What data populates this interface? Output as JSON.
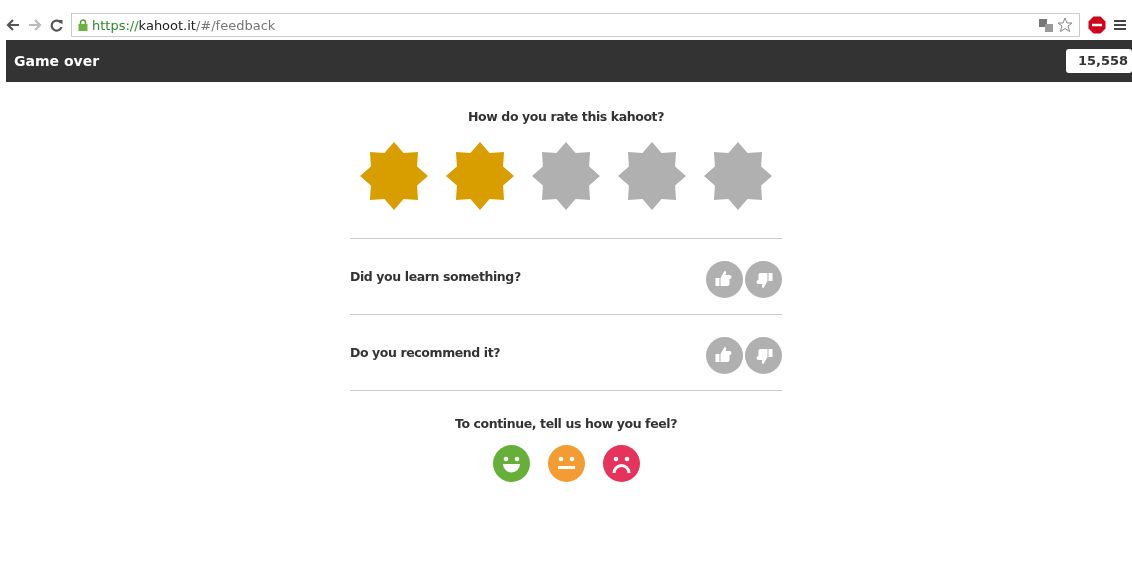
{
  "browser": {
    "url_scheme": "https://",
    "url_host": "kahoot.it",
    "url_path": "/#/feedback"
  },
  "header": {
    "title": "Game over",
    "score": "15,558"
  },
  "rating": {
    "question": "How do you rate this kahoot?",
    "stars": 2
  },
  "questions": [
    {
      "label": "Did you learn something?"
    },
    {
      "label": "Do you recommend it?"
    }
  ],
  "mood": {
    "prompt": "To continue, tell us how you feel?",
    "options": [
      {
        "kind": "happy",
        "color": "#66b03a"
      },
      {
        "kind": "neutral",
        "color": "#f39c34"
      },
      {
        "kind": "sad",
        "color": "#e5335b"
      }
    ]
  }
}
